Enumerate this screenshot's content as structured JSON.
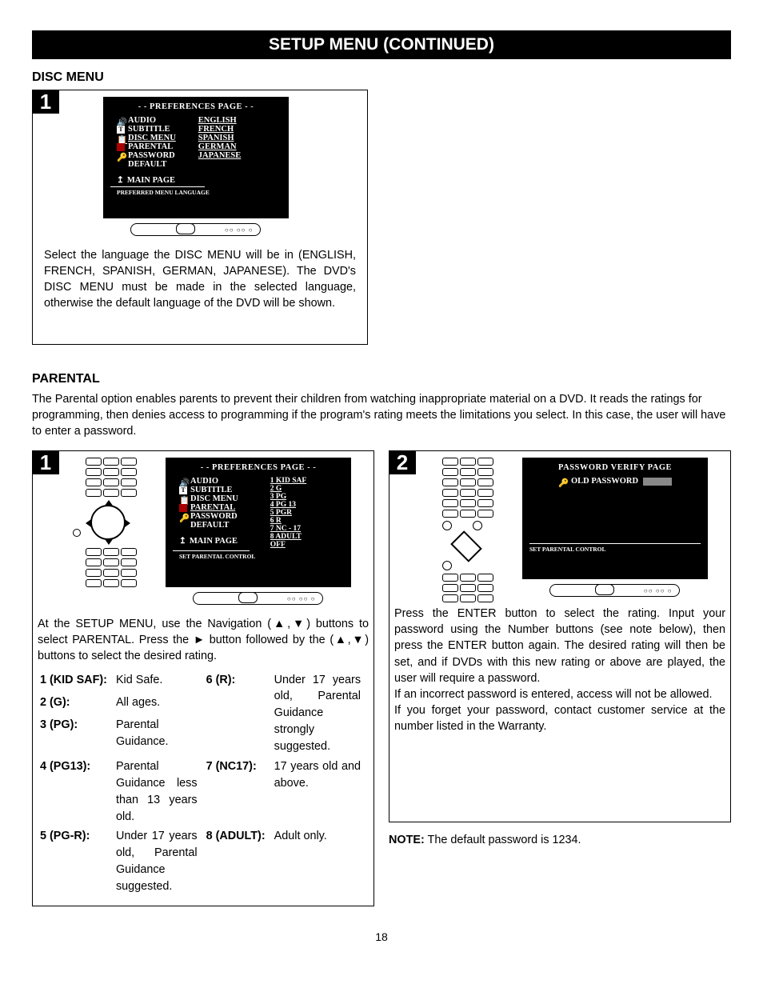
{
  "header": "SETUP MENU (CONTINUED)",
  "section1": {
    "title": "DISC MENU",
    "step_num": "1",
    "screen": {
      "title": "- - PREFERENCES PAGE - -",
      "items": [
        "AUDIO",
        "SUBTITLE",
        "DISC MENU",
        "PARENTAL",
        "PASSWORD",
        "DEFAULT"
      ],
      "options": [
        "ENGLISH",
        "FRENCH",
        "SPANISH",
        "GERMAN",
        "JAPANESE"
      ],
      "main_page": "MAIN PAGE",
      "footer": "PREFERRED MENU LANGUAGE"
    },
    "caption": "Select the language the DISC MENU will be in (ENGLISH, FRENCH, SPANISH, GERMAN, JAPANESE). The DVD's DISC MENU must be made in the selected language, otherwise the default language of the DVD will be shown."
  },
  "section2": {
    "title": "PARENTAL",
    "intro": "The Parental option enables parents to prevent their children from watching inappropriate material on a DVD. It reads the ratings for programming, then denies access to programming if the program's rating meets the limitations you select. In this case, the user will have to enter a password.",
    "step1": {
      "num": "1",
      "screen": {
        "title": "- - PREFERENCES PAGE - -",
        "items": [
          "AUDIO",
          "SUBTITLE",
          "DISC MENU",
          "PARENTAL",
          "PASSWORD",
          "DEFAULT"
        ],
        "options": [
          "1  KID SAF",
          "2  G",
          "3  PG",
          "4  PG  13",
          "5  PGR",
          "6  R",
          "7  NC - 17",
          "8  ADULT",
          "OFF"
        ],
        "main_page": "MAIN PAGE",
        "footer": "SET PARENTAL CONTROL"
      },
      "caption_l1": "At the SETUP MENU, use the Navigation (▲,▼) buttons to select PARENTAL. Press the ► button    followed by the (▲,▼) buttons    to select the desired rating.",
      "ratings": [
        {
          "lbl": "1 (KID SAF):",
          "txt": "Kid Safe."
        },
        {
          "lbl": "2 (G):",
          "txt": "All ages."
        },
        {
          "lbl": "3 (PG):",
          "txt": "Parental Guidance."
        },
        {
          "lbl": "4 (PG13):",
          "txt": "Parental Guidance less than 13 years old."
        },
        {
          "lbl": "5 (PG-R):",
          "txt": "Under 17 years old, Parental Guidance suggested."
        },
        {
          "lbl": "6 (R):",
          "txt": "Under 17 years old, Parental Guidance strongly suggested."
        },
        {
          "lbl": "7 (NC17):",
          "txt": "17 years old and above."
        },
        {
          "lbl": "8 (ADULT):",
          "txt": "Adult only."
        }
      ]
    },
    "step2": {
      "num": "2",
      "screen": {
        "title": "PASSWORD VERIFY PAGE",
        "old_pw_label": "OLD PASSWORD",
        "footer": "SET PARENTAL CONTROL"
      },
      "caption": "Press the ENTER button        to select the rating. Input your password using the Number buttons      (see note below), then press the ENTER button      again. The desired rating will then be set, and if DVDs with this new rating or above are played, the user will require a password.\nIf an incorrect password is entered, access will not be allowed.\nIf you forget your password, contact customer service at the number listed in the Warranty."
    },
    "note_label": "NOTE:",
    "note_text": " The default password is 1234."
  },
  "page_no": "18"
}
